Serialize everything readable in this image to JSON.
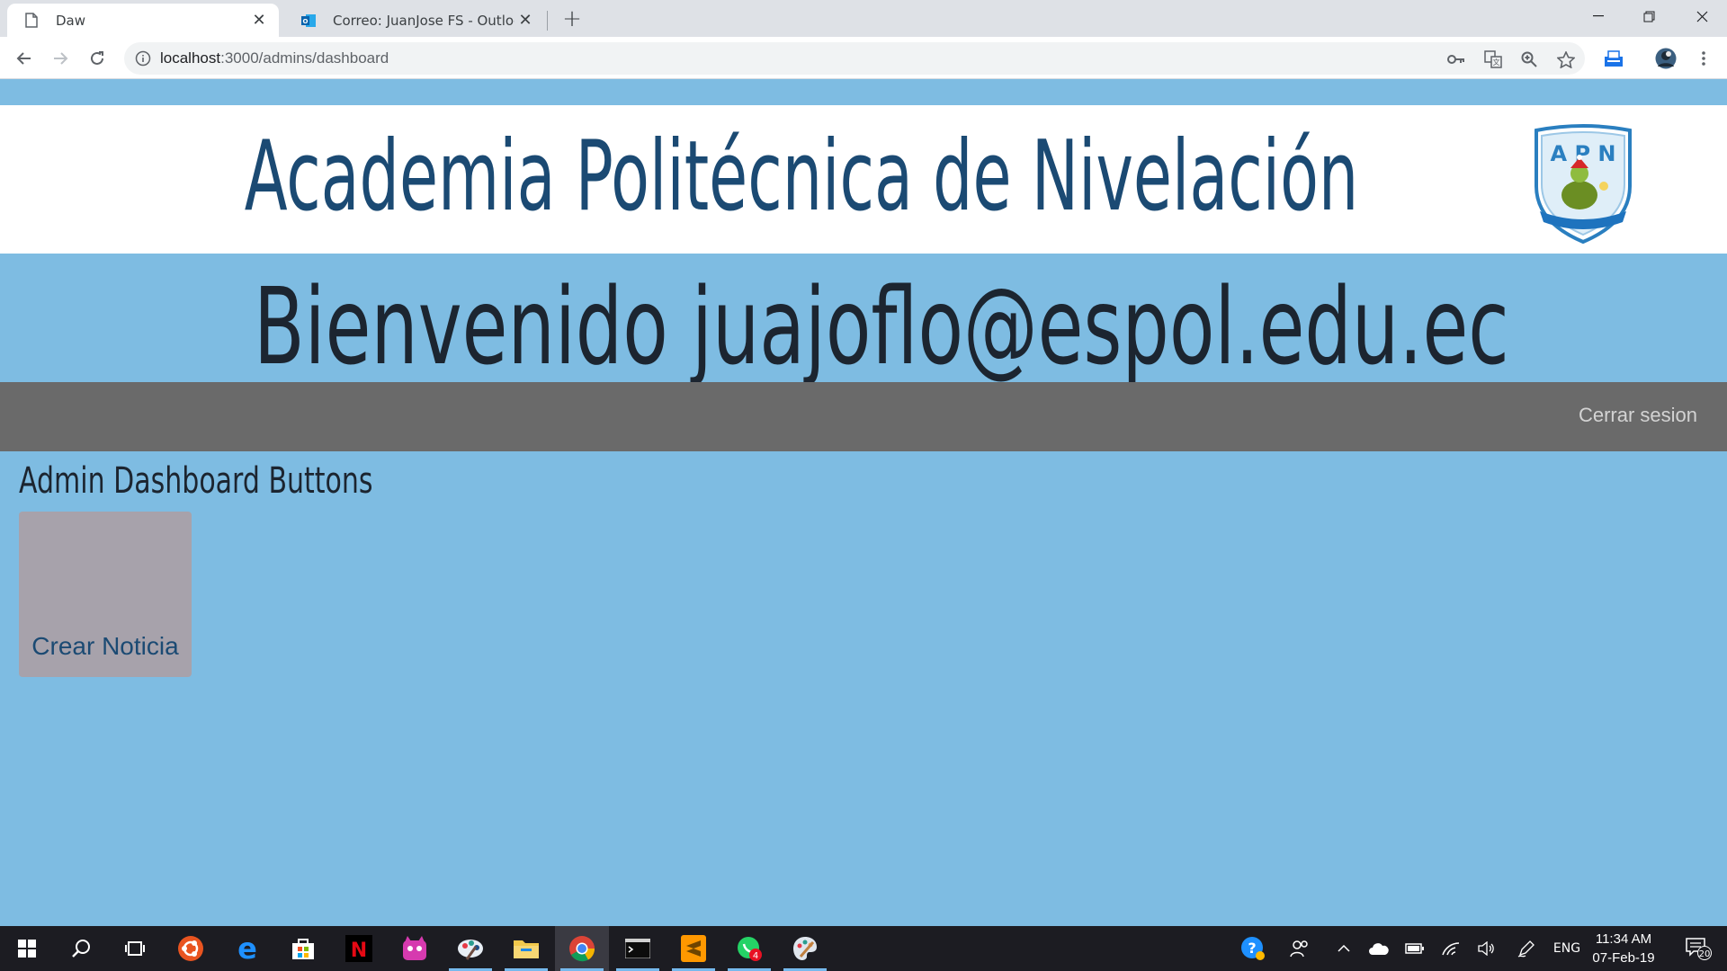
{
  "browser": {
    "tabs": [
      {
        "title": "Daw",
        "favicon": "page-icon",
        "active": true
      },
      {
        "title": "Correo: JuanJose FS - Outlook",
        "favicon": "outlook-icon",
        "active": false
      }
    ],
    "url_host": "localhost",
    "url_path": ":3000/admins/dashboard"
  },
  "page": {
    "site_title": "Academia Politécnica de Nivelación",
    "logo_text": "A P N",
    "welcome": "Bienvenido juajoflo@espol.edu.ec",
    "logout_label": "Cerrar sesion",
    "section_title": "Admin Dashboard Buttons",
    "buttons": [
      {
        "label": "Crear Noticia"
      }
    ]
  },
  "taskbar": {
    "apps": [
      "start-icon",
      "search-icon",
      "task-view-icon",
      "ubuntu-icon",
      "edge-icon",
      "store-icon",
      "netflix-icon",
      "monster-icon",
      "paint-icon",
      "file-explorer-icon",
      "chrome-icon",
      "terminal-icon",
      "sublime-icon",
      "whatsapp-icon",
      "paint3d-icon"
    ],
    "whatsapp_badge": "4",
    "language": "ENG",
    "time": "11:34 AM",
    "date": "07-Feb-19",
    "notifications": "20"
  },
  "colors": {
    "page_bg": "#7ebce2",
    "title_blue": "#1b4a73",
    "navbar_gray": "#6a6a6a",
    "button_gray": "#a7a2ab"
  }
}
